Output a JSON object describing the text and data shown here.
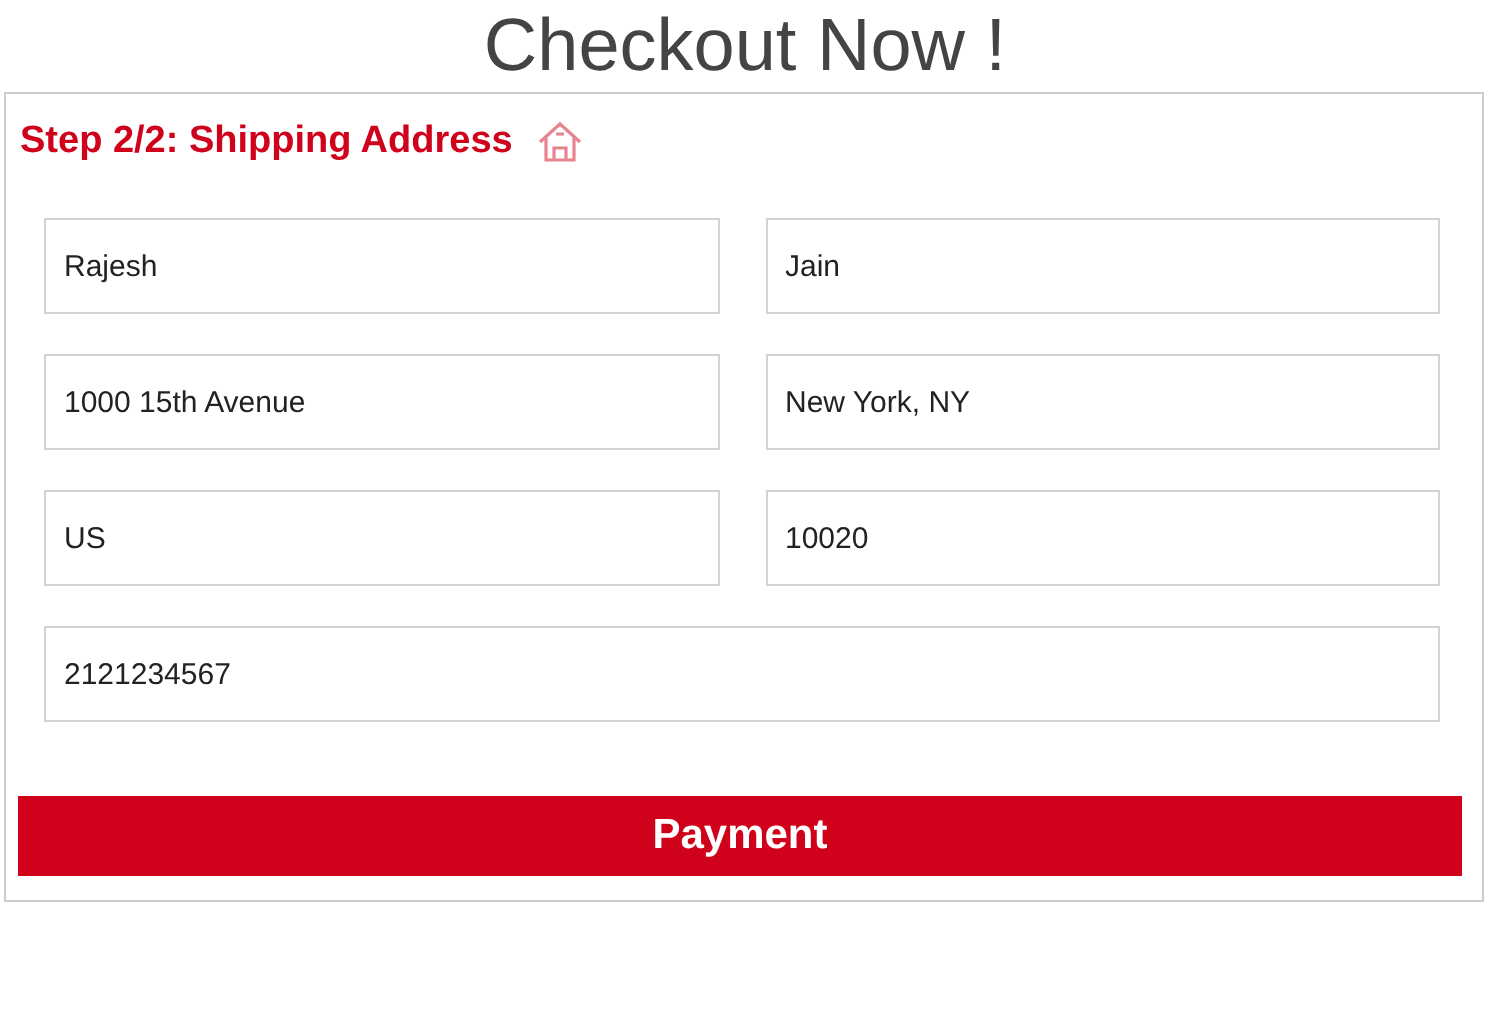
{
  "title": "Checkout Now !",
  "step": {
    "heading": "Step 2/2: Shipping Address"
  },
  "rows": [
    {
      "fields": [
        {
          "value": "Rajesh"
        },
        {
          "value": "Jain"
        }
      ]
    },
    {
      "fields": [
        {
          "value": "1000 15th Avenue"
        },
        {
          "value": "New York, NY"
        }
      ]
    },
    {
      "fields": [
        {
          "value": "US"
        },
        {
          "value": "10020"
        }
      ]
    },
    {
      "fields": [
        {
          "value": "2121234567"
        }
      ]
    }
  ],
  "button": "Payment"
}
